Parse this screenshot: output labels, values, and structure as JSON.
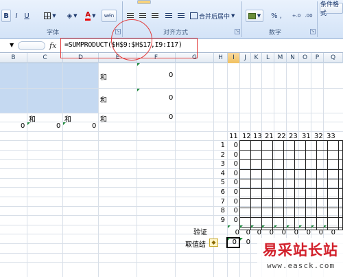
{
  "ribbon": {
    "font_group_label": "字体",
    "align_group_label": "对齐方式",
    "number_group_label": "数字",
    "merge_center_label": "合并后居中",
    "number_format_label": "% ,",
    "conditional_format_label": "条件格式",
    "bold_label": "B",
    "italic_label": "I",
    "underline_label": "U",
    "font_color_label": "A",
    "wen_label": "wén"
  },
  "formula_bar": {
    "fx": "fx",
    "formula": "=SUMPRODUCT($H$9:$H$17,I9:I17)"
  },
  "columns": [
    "B",
    "C",
    "D",
    "E",
    "F",
    "G",
    "H",
    "I",
    "J",
    "K",
    "L",
    "M",
    "N",
    "O",
    "P",
    "Q"
  ],
  "cells": {
    "e1": "和",
    "f1": "0",
    "e2": "和",
    "f2": "0",
    "c3": "和",
    "d3": "和",
    "e3": "和",
    "f3": "0",
    "b4": "0",
    "c4": "0",
    "d4": "0"
  },
  "mini_table": {
    "headers": [
      "11",
      "12",
      "13",
      "21",
      "22",
      "23",
      "31",
      "32",
      "33"
    ],
    "rows": [
      "1",
      "2",
      "3",
      "4",
      "5",
      "6",
      "7",
      "8",
      "9"
    ],
    "zero": "0",
    "verify_label": "验证",
    "result_label": "取值结",
    "verify_values": [
      "0",
      "0",
      "0",
      "0",
      "0",
      "0",
      "0",
      "0",
      "0"
    ],
    "result_values": [
      "0",
      "0"
    ]
  },
  "watermark": {
    "title": "易采站长站",
    "url": "www.easck.com"
  }
}
